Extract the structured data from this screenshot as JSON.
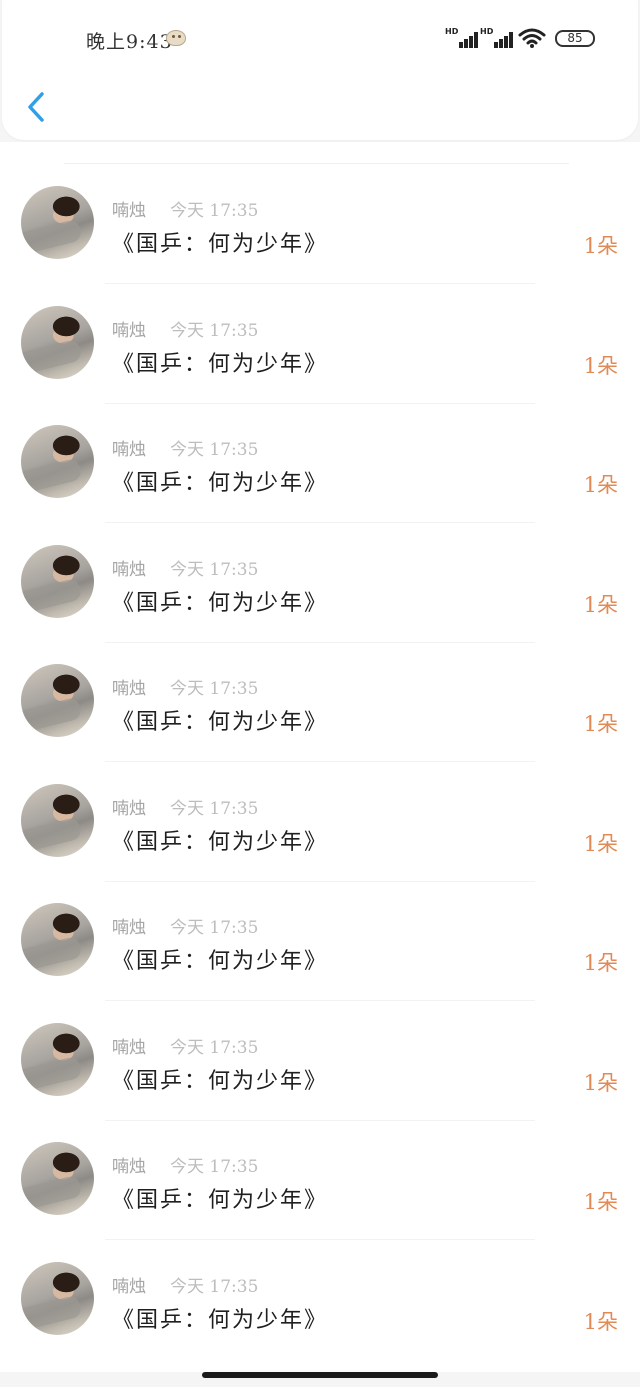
{
  "status_bar": {
    "time": "晚上9:43",
    "signal_1_label": "HD",
    "signal_2_label": "HD",
    "battery": "85"
  },
  "colors": {
    "accent_back": "#2f9fe8",
    "flower_count": "#e28a55"
  },
  "messages": [
    {
      "sender": "喃烛",
      "time": "今天 17:35",
      "text": "《国乒：何为少年》",
      "count": "1朵"
    },
    {
      "sender": "喃烛",
      "time": "今天 17:35",
      "text": "《国乒：何为少年》",
      "count": "1朵"
    },
    {
      "sender": "喃烛",
      "time": "今天 17:35",
      "text": "《国乒：何为少年》",
      "count": "1朵"
    },
    {
      "sender": "喃烛",
      "time": "今天 17:35",
      "text": "《国乒：何为少年》",
      "count": "1朵"
    },
    {
      "sender": "喃烛",
      "time": "今天 17:35",
      "text": "《国乒：何为少年》",
      "count": "1朵"
    },
    {
      "sender": "喃烛",
      "time": "今天 17:35",
      "text": "《国乒：何为少年》",
      "count": "1朵"
    },
    {
      "sender": "喃烛",
      "time": "今天 17:35",
      "text": "《国乒：何为少年》",
      "count": "1朵"
    },
    {
      "sender": "喃烛",
      "time": "今天 17:35",
      "text": "《国乒：何为少年》",
      "count": "1朵"
    },
    {
      "sender": "喃烛",
      "time": "今天 17:35",
      "text": "《国乒：何为少年》",
      "count": "1朵"
    },
    {
      "sender": "喃烛",
      "time": "今天 17:35",
      "text": "《国乒：何为少年》",
      "count": "1朵"
    }
  ]
}
